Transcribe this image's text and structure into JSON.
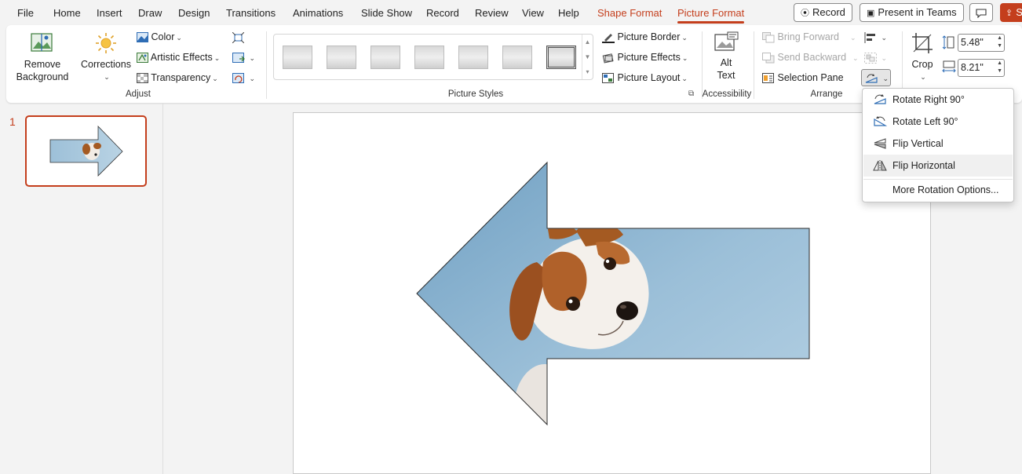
{
  "menu": {
    "tabs": [
      "File",
      "Home",
      "Insert",
      "Draw",
      "Design",
      "Transitions",
      "Animations",
      "Slide Show",
      "Record",
      "Review",
      "View",
      "Help"
    ],
    "contextual_tabs": [
      "Shape Format",
      "Picture Format"
    ],
    "active_tab": "Picture Format",
    "record_label": "Record",
    "present_label": "Present in Teams",
    "share_label": "S"
  },
  "ribbon": {
    "adjust": {
      "remove_background": [
        "Remove",
        "Background"
      ],
      "corrections": "Corrections",
      "color": "Color",
      "artistic_effects": "Artistic Effects",
      "transparency": "Transparency",
      "group_label": "Adjust"
    },
    "picture_styles": {
      "group_label": "Picture Styles",
      "picture_border": "Picture Border",
      "picture_effects": "Picture Effects",
      "picture_layout": "Picture Layout"
    },
    "accessibility": {
      "alt_text": [
        "Alt",
        "Text"
      ],
      "group_label": "Accessibility"
    },
    "arrange": {
      "bring_forward": "Bring Forward",
      "send_backward": "Send Backward",
      "selection_pane": "Selection Pane",
      "group_label": "Arrange"
    },
    "size": {
      "crop": "Crop",
      "height": "5.48\"",
      "width": "8.21\""
    }
  },
  "slides": {
    "current_number": "1"
  },
  "rotate_menu": {
    "items": [
      {
        "label": "Rotate Right 90°",
        "icon": "rotate-right-icon"
      },
      {
        "label": "Rotate Left 90°",
        "icon": "rotate-left-icon"
      },
      {
        "label": "Flip Vertical",
        "icon": "flip-vertical-icon"
      },
      {
        "label": "Flip Horizontal",
        "icon": "flip-horizontal-icon"
      }
    ],
    "more_options": "More Rotation Options...",
    "hovered_item": "Flip Horizontal"
  },
  "colors": {
    "accent": "#c43e1c",
    "photo_sky": "#8fb6d1",
    "dog_brown": "#a45a22"
  }
}
